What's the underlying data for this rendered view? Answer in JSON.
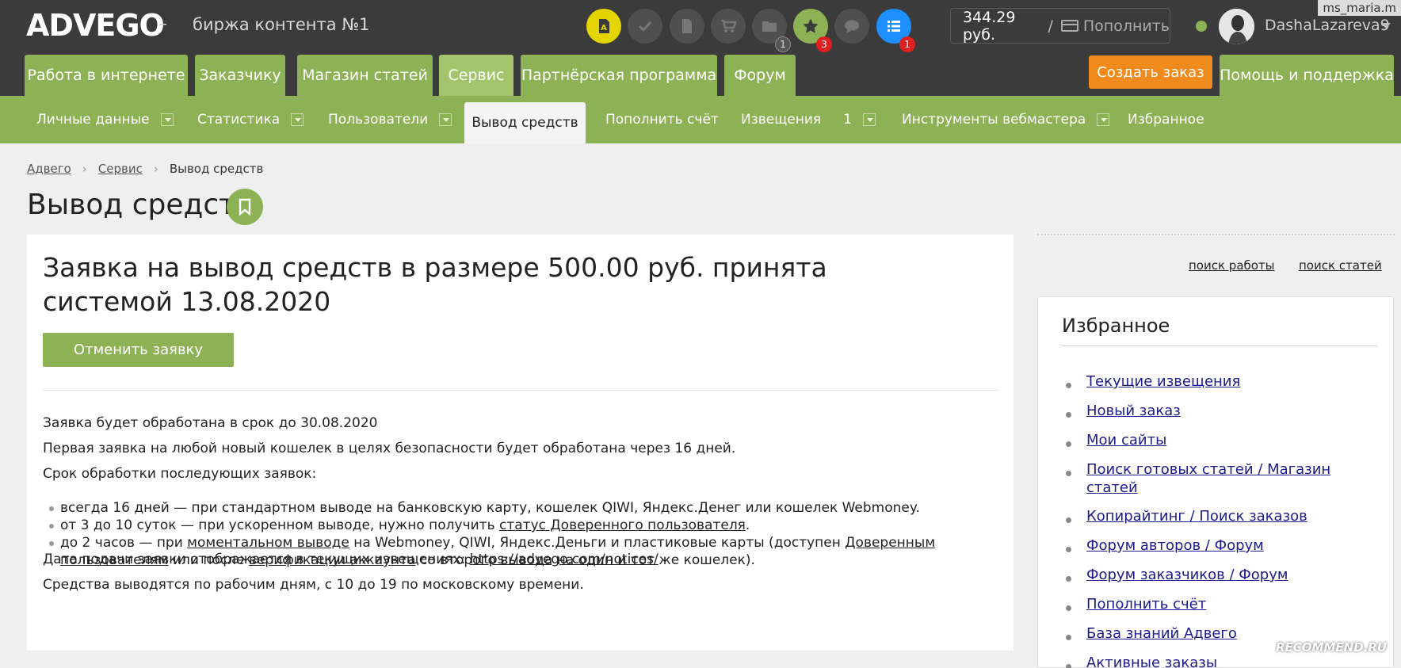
{
  "header": {
    "logo": "ADVEGO",
    "dash": "–",
    "tagline": "биржа контента №1",
    "watermark": "ms_maria.m",
    "icons": [
      {
        "name": "font-icon",
        "color": "#e4d400",
        "badge": ""
      },
      {
        "name": "check-icon",
        "color": "#4f4f4f",
        "badge": ""
      },
      {
        "name": "document-icon",
        "color": "#4f4f4f",
        "badge": ""
      },
      {
        "name": "cart-icon",
        "color": "#4f4f4f",
        "badge": ""
      },
      {
        "name": "folder-icon",
        "color": "#4f4f4f",
        "badge": "1"
      },
      {
        "name": "star-icon",
        "color": "#8db255",
        "badge": "3"
      },
      {
        "name": "chat-icon",
        "color": "#4f4f4f",
        "badge": ""
      },
      {
        "name": "list-icon",
        "color": "#1e90ff",
        "badge": "1"
      }
    ],
    "balance": "344.29 руб.",
    "slash": "/",
    "topup": "Пополнить",
    "username": "DashaLazareva9",
    "colors": {
      "green": "#8db255",
      "orange": "#f08a1c",
      "dark": "#3b3b3b",
      "badge_red": "#e02020"
    }
  },
  "main_tabs": [
    "Работа в интернете",
    "Заказчику",
    "Магазин статей",
    "Сервис",
    "Партнёрская программа",
    "Форум"
  ],
  "create_order": "Создать заказ",
  "help": "Помощь и поддержка",
  "sub_nav": [
    "Личные данные",
    "Статистика",
    "Пользователи",
    "Вывод средств",
    "Пополнить счёт",
    "Извещения",
    "Инструменты вебмастера",
    "Избранное"
  ],
  "notices_count": "1",
  "breadcrumb": [
    "Адвего",
    "Сервис",
    "Вывод средств"
  ],
  "page_title": "Вывод средств",
  "content": {
    "notice_title": "Заявка на вывод средств в размере 500.00 руб. принята системой 13.08.2020",
    "cancel": "Отменить заявку",
    "p1": "Заявка будет обработана в срок до 30.08.2020",
    "p2": "Первая заявка на любой новый кошелек в целях безопасности будет обработана через 16 дней.",
    "p3": "Срок обработки последующих заявок:",
    "b1": "всегда 16 дней — при стандартном выводе на банковскую карту, кошелек QIWI, Яндекс.Денег или кошелек Webmoney.",
    "b2_a": "от 3 до 10 суток — при ускоренном выводе, нужно получить ",
    "b2_link": "статус Доверенного пользователя",
    "b2_b": ".",
    "b3_a": "до 2 часов — при ",
    "b3_link1": "моментальном выводе",
    "b3_b": " на Webmoney, QIWI, Яндекс.Деньги и пластиковые карты (доступен ",
    "b3_link2": "Доверенным пользователям",
    "b3_c": " или после ",
    "b3_link3": "верификации аккаунта",
    "b3_d": " со второго вывода на один и тот же кошелек).",
    "p4_a": "Дата подачи заявки отображается в текущих извещениях: ",
    "p4_link": "https://advego.com/notices/",
    "p5": "Средства выводятся по рабочим дням, с 10 до 19 по московскому времени."
  },
  "sidebar": {
    "search_work": "поиск работы",
    "search_articles": "поиск статей",
    "fav_title": "Избранное",
    "items": [
      "Текущие извещения",
      "Новый заказ",
      "Мои сайты",
      "Поиск готовых статей / Магазин статей",
      "Копирайтинг / Поиск заказов",
      "Форум авторов / Форум",
      "Форум заказчиков / Форум",
      "Пополнить счёт",
      "База знаний Адвего",
      "Активные заказы"
    ]
  },
  "recommend_watermark": "RECOMMEND.RU"
}
